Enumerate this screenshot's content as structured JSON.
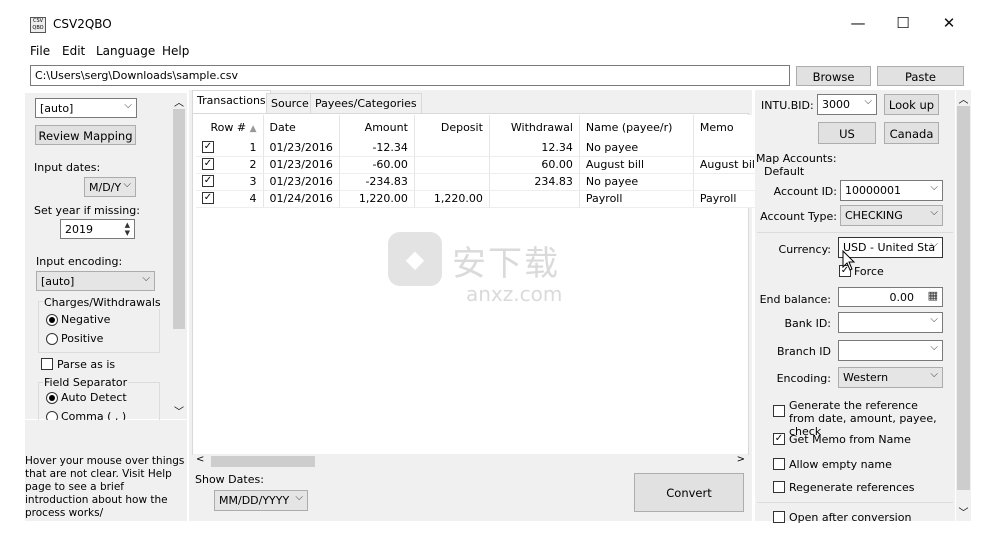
{
  "window": {
    "title": "CSV2QBO",
    "icon_text": "CSV QBO",
    "controls": {
      "minimize": "—",
      "maximize": "☐",
      "close": "✕"
    }
  },
  "menu": [
    "File",
    "Edit",
    "Language",
    "Help"
  ],
  "path": {
    "value": "C:\\Users\\serg\\Downloads\\sample.csv",
    "browse": "Browse",
    "paste": "Paste"
  },
  "left": {
    "mapping_combo": "[auto]",
    "review_mapping": "Review Mapping",
    "input_dates_label": "Input dates:",
    "date_format": "M/D/Y",
    "set_year_label": "Set year if missing:",
    "year": "2019",
    "input_encoding_label": "Input encoding:",
    "encoding": "[auto]",
    "charges_label": "Charges/Withdrawals",
    "negative": "Negative",
    "positive": "Positive",
    "parse_as_is": "Parse as is",
    "field_sep_label": "Field Separator",
    "auto_detect": "Auto Detect",
    "comma": "Comma ( , )",
    "help_text": "Hover your mouse over things that are not clear. Visit Help page to see a brief introduction about how the process works/"
  },
  "tabs": [
    "Transactions",
    "Source",
    "Payees/Categories"
  ],
  "table": {
    "columns": [
      "Row #",
      "Date",
      "Amount",
      "Deposit",
      "Withdrawal",
      "Name (payee/r)",
      "Memo"
    ],
    "rows": [
      {
        "check": "✓",
        "row": "1",
        "date": "01/23/2016",
        "amount": "-12.34",
        "deposit": "",
        "withdrawal": "12.34",
        "name": "No payee",
        "memo": ""
      },
      {
        "check": "✓",
        "row": "2",
        "date": "01/23/2016",
        "amount": "-60.00",
        "deposit": "",
        "withdrawal": "60.00",
        "name": "August bill",
        "memo": "August bill"
      },
      {
        "check": "✓",
        "row": "3",
        "date": "01/23/2016",
        "amount": "-234.83",
        "deposit": "",
        "withdrawal": "234.83",
        "name": "No payee",
        "memo": ""
      },
      {
        "check": "✓",
        "row": "4",
        "date": "01/24/2016",
        "amount": "1,220.00",
        "deposit": "1,220.00",
        "withdrawal": "",
        "name": "Payroll",
        "memo": "Payroll"
      }
    ]
  },
  "bottom": {
    "show_dates_label": "Show Dates:",
    "show_dates": "MM/DD/YYYY",
    "convert": "Convert"
  },
  "right": {
    "intu_label": "INTU.BID:",
    "intu_value": "3000",
    "lookup": "Look up",
    "us": "US",
    "canada": "Canada",
    "map_accounts": "Map Accounts:",
    "default": "Default",
    "account_id_label": "Account ID:",
    "account_id": "10000001",
    "account_type_label": "Account Type:",
    "account_type": "CHECKING",
    "currency_label": "Currency:",
    "currency": "USD - United Sta",
    "force": "Force",
    "end_balance_label": "End balance:",
    "end_balance": "0.00",
    "bank_id_label": "Bank ID:",
    "branch_id_label": "Branch ID",
    "encoding_label": "Encoding:",
    "encoding": "Western",
    "generate_ref": "Generate the reference from date, amount, payee, check",
    "get_memo": "Get Memo from Name",
    "allow_empty": "Allow empty name",
    "regen_refs": "Regenerate references",
    "open_after": "Open after conversion"
  },
  "watermark": {
    "text": "安下载",
    "sub": "anxz.com"
  }
}
